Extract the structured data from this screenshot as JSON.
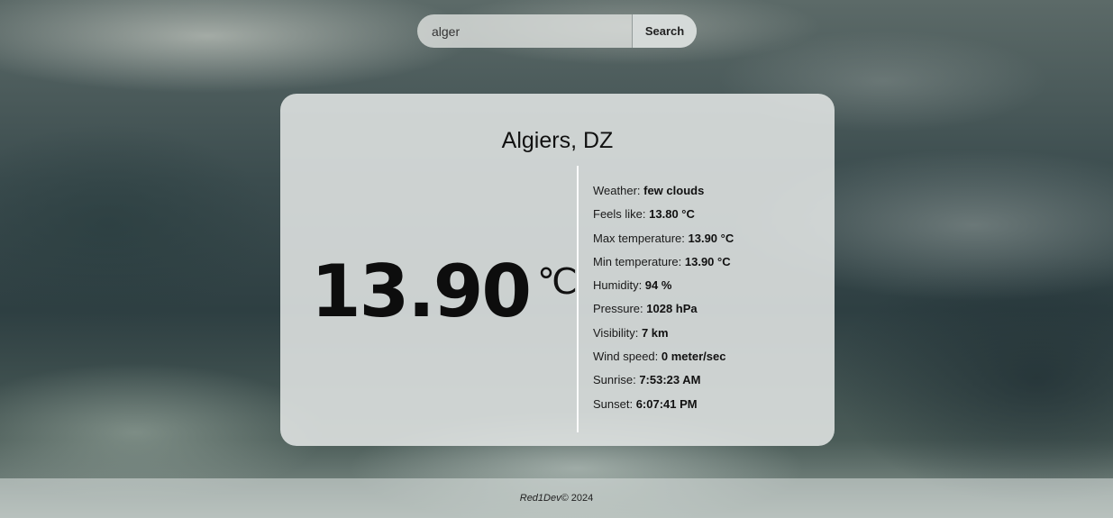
{
  "search": {
    "value": "alger",
    "button_label": "Search"
  },
  "card": {
    "city": "Algiers, DZ",
    "temperature": "13.90",
    "unit": "℃",
    "details": [
      {
        "label": "Weather: ",
        "value": "few clouds"
      },
      {
        "label": "Feels like: ",
        "value": "13.80 °C"
      },
      {
        "label": "Max temperature: ",
        "value": "13.90 °C"
      },
      {
        "label": "Min temperature: ",
        "value": "13.90 °C"
      },
      {
        "label": "Humidity: ",
        "value": "94 %"
      },
      {
        "label": "Pressure: ",
        "value": "1028 hPa"
      },
      {
        "label": "Visibility: ",
        "value": "7 km"
      },
      {
        "label": "Wind speed: ",
        "value": "0 meter/sec"
      },
      {
        "label": "Sunrise: ",
        "value": "7:53:23 AM"
      },
      {
        "label": "Sunset: ",
        "value": "6:07:41 PM"
      }
    ]
  },
  "footer": {
    "brand": "Red1Dev",
    "copyright": " © 2024"
  }
}
